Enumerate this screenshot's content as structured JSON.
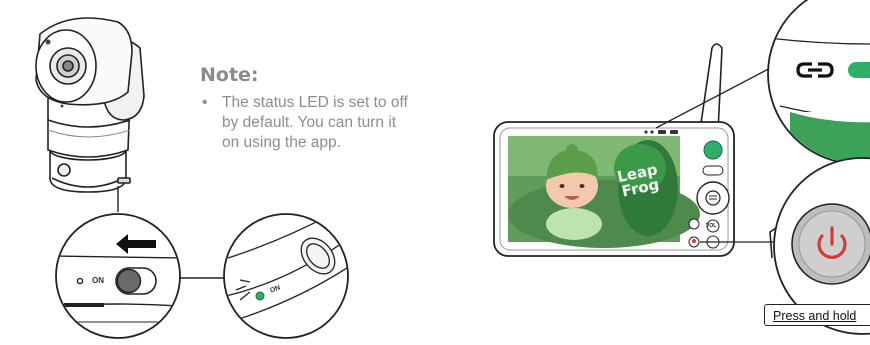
{
  "note": {
    "title": "Note:",
    "bullet": "•",
    "text": "The status LED is set to off by default. You can turn it on using the app."
  },
  "camera_switch": {
    "on_label": "ON"
  },
  "led_callout": {
    "on_label": "ON"
  },
  "parent_unit": {
    "brand_lines": [
      "Leap",
      "Frog"
    ],
    "vol_label": "VOL"
  },
  "power_callout": {
    "label": "Press and hold"
  },
  "colors": {
    "accent_green": "#2fae6a",
    "power_red": "#d63b3b",
    "line_dark": "#222222",
    "note_gray": "#8a8a8a"
  }
}
